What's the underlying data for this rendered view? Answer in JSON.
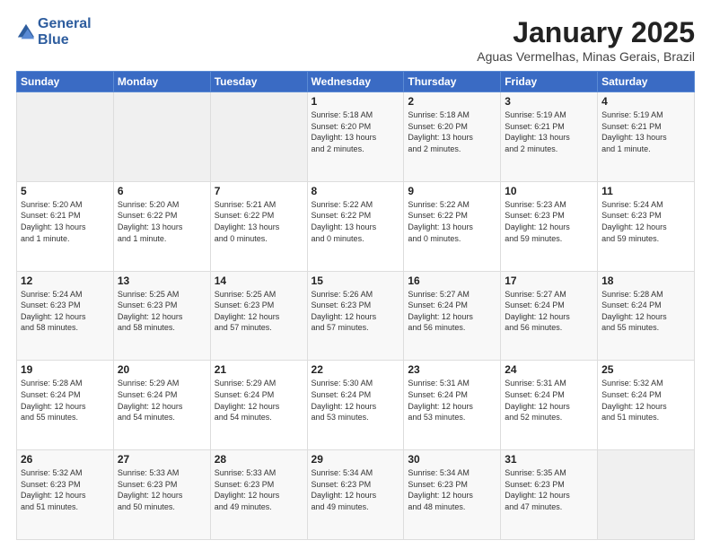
{
  "logo": {
    "line1": "General",
    "line2": "Blue"
  },
  "title": "January 2025",
  "subtitle": "Aguas Vermelhas, Minas Gerais, Brazil",
  "days_of_week": [
    "Sunday",
    "Monday",
    "Tuesday",
    "Wednesday",
    "Thursday",
    "Friday",
    "Saturday"
  ],
  "weeks": [
    [
      {
        "day": "",
        "info": ""
      },
      {
        "day": "",
        "info": ""
      },
      {
        "day": "",
        "info": ""
      },
      {
        "day": "1",
        "info": "Sunrise: 5:18 AM\nSunset: 6:20 PM\nDaylight: 13 hours\nand 2 minutes."
      },
      {
        "day": "2",
        "info": "Sunrise: 5:18 AM\nSunset: 6:20 PM\nDaylight: 13 hours\nand 2 minutes."
      },
      {
        "day": "3",
        "info": "Sunrise: 5:19 AM\nSunset: 6:21 PM\nDaylight: 13 hours\nand 2 minutes."
      },
      {
        "day": "4",
        "info": "Sunrise: 5:19 AM\nSunset: 6:21 PM\nDaylight: 13 hours\nand 1 minute."
      }
    ],
    [
      {
        "day": "5",
        "info": "Sunrise: 5:20 AM\nSunset: 6:21 PM\nDaylight: 13 hours\nand 1 minute."
      },
      {
        "day": "6",
        "info": "Sunrise: 5:20 AM\nSunset: 6:22 PM\nDaylight: 13 hours\nand 1 minute."
      },
      {
        "day": "7",
        "info": "Sunrise: 5:21 AM\nSunset: 6:22 PM\nDaylight: 13 hours\nand 0 minutes."
      },
      {
        "day": "8",
        "info": "Sunrise: 5:22 AM\nSunset: 6:22 PM\nDaylight: 13 hours\nand 0 minutes."
      },
      {
        "day": "9",
        "info": "Sunrise: 5:22 AM\nSunset: 6:22 PM\nDaylight: 13 hours\nand 0 minutes."
      },
      {
        "day": "10",
        "info": "Sunrise: 5:23 AM\nSunset: 6:23 PM\nDaylight: 12 hours\nand 59 minutes."
      },
      {
        "day": "11",
        "info": "Sunrise: 5:24 AM\nSunset: 6:23 PM\nDaylight: 12 hours\nand 59 minutes."
      }
    ],
    [
      {
        "day": "12",
        "info": "Sunrise: 5:24 AM\nSunset: 6:23 PM\nDaylight: 12 hours\nand 58 minutes."
      },
      {
        "day": "13",
        "info": "Sunrise: 5:25 AM\nSunset: 6:23 PM\nDaylight: 12 hours\nand 58 minutes."
      },
      {
        "day": "14",
        "info": "Sunrise: 5:25 AM\nSunset: 6:23 PM\nDaylight: 12 hours\nand 57 minutes."
      },
      {
        "day": "15",
        "info": "Sunrise: 5:26 AM\nSunset: 6:23 PM\nDaylight: 12 hours\nand 57 minutes."
      },
      {
        "day": "16",
        "info": "Sunrise: 5:27 AM\nSunset: 6:24 PM\nDaylight: 12 hours\nand 56 minutes."
      },
      {
        "day": "17",
        "info": "Sunrise: 5:27 AM\nSunset: 6:24 PM\nDaylight: 12 hours\nand 56 minutes."
      },
      {
        "day": "18",
        "info": "Sunrise: 5:28 AM\nSunset: 6:24 PM\nDaylight: 12 hours\nand 55 minutes."
      }
    ],
    [
      {
        "day": "19",
        "info": "Sunrise: 5:28 AM\nSunset: 6:24 PM\nDaylight: 12 hours\nand 55 minutes."
      },
      {
        "day": "20",
        "info": "Sunrise: 5:29 AM\nSunset: 6:24 PM\nDaylight: 12 hours\nand 54 minutes."
      },
      {
        "day": "21",
        "info": "Sunrise: 5:29 AM\nSunset: 6:24 PM\nDaylight: 12 hours\nand 54 minutes."
      },
      {
        "day": "22",
        "info": "Sunrise: 5:30 AM\nSunset: 6:24 PM\nDaylight: 12 hours\nand 53 minutes."
      },
      {
        "day": "23",
        "info": "Sunrise: 5:31 AM\nSunset: 6:24 PM\nDaylight: 12 hours\nand 53 minutes."
      },
      {
        "day": "24",
        "info": "Sunrise: 5:31 AM\nSunset: 6:24 PM\nDaylight: 12 hours\nand 52 minutes."
      },
      {
        "day": "25",
        "info": "Sunrise: 5:32 AM\nSunset: 6:24 PM\nDaylight: 12 hours\nand 51 minutes."
      }
    ],
    [
      {
        "day": "26",
        "info": "Sunrise: 5:32 AM\nSunset: 6:23 PM\nDaylight: 12 hours\nand 51 minutes."
      },
      {
        "day": "27",
        "info": "Sunrise: 5:33 AM\nSunset: 6:23 PM\nDaylight: 12 hours\nand 50 minutes."
      },
      {
        "day": "28",
        "info": "Sunrise: 5:33 AM\nSunset: 6:23 PM\nDaylight: 12 hours\nand 49 minutes."
      },
      {
        "day": "29",
        "info": "Sunrise: 5:34 AM\nSunset: 6:23 PM\nDaylight: 12 hours\nand 49 minutes."
      },
      {
        "day": "30",
        "info": "Sunrise: 5:34 AM\nSunset: 6:23 PM\nDaylight: 12 hours\nand 48 minutes."
      },
      {
        "day": "31",
        "info": "Sunrise: 5:35 AM\nSunset: 6:23 PM\nDaylight: 12 hours\nand 47 minutes."
      },
      {
        "day": "",
        "info": ""
      }
    ]
  ]
}
